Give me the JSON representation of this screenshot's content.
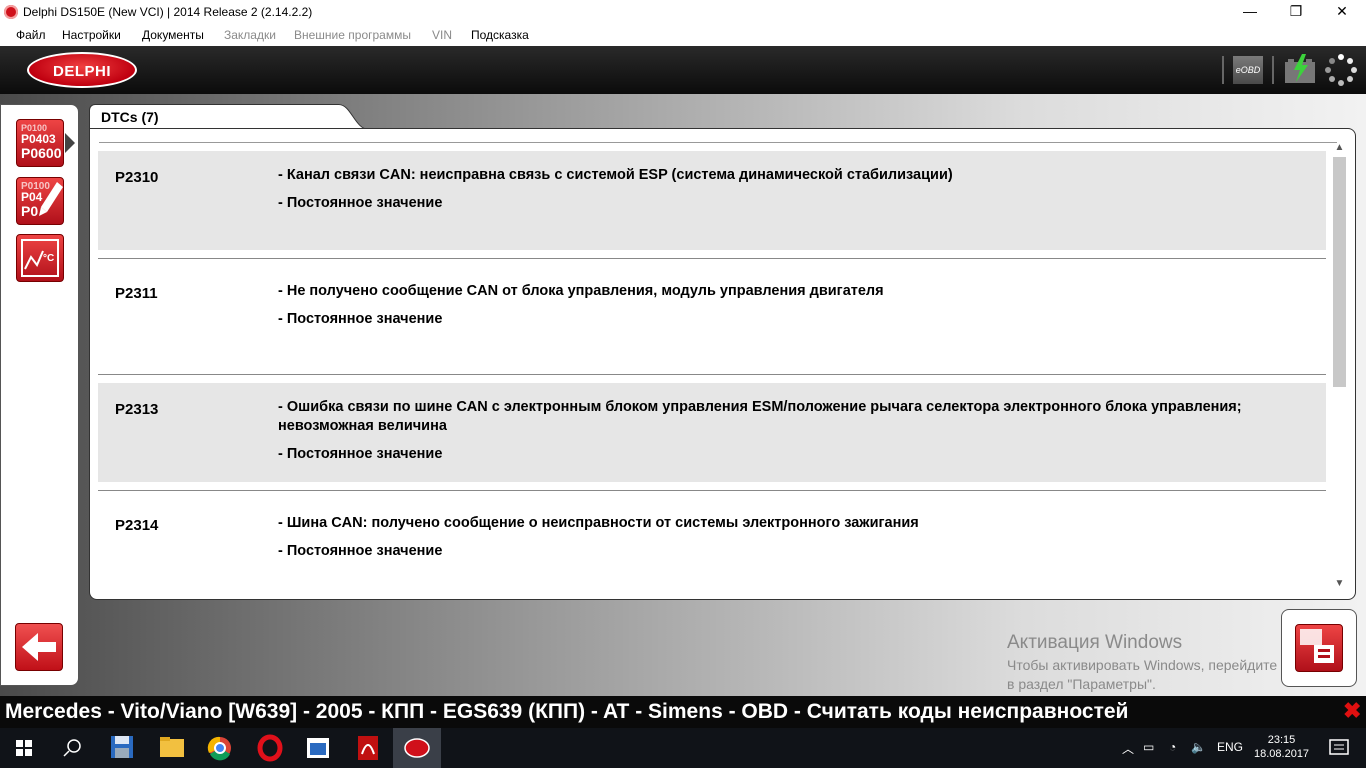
{
  "window": {
    "title": "Delphi DS150E (New VCI) | 2014 Release 2 (2.14.2.2)",
    "minimize_glyph": "—",
    "maximize_glyph": "❐",
    "close_glyph": "✕"
  },
  "menu": {
    "items": [
      {
        "label": "Файл",
        "enabled": true
      },
      {
        "label": "Настройки",
        "enabled": true
      },
      {
        "label": "Документы",
        "enabled": true
      },
      {
        "label": "Закладки",
        "enabled": false
      },
      {
        "label": "Внешние программы",
        "enabled": false
      },
      {
        "label": "VIN",
        "enabled": false
      },
      {
        "label": "Подсказка",
        "enabled": true
      }
    ]
  },
  "header": {
    "logo_text": "DELPHI",
    "eobd_label": "eOBD",
    "icons": [
      "eobd-icon",
      "battery-charge-icon",
      "loading-spinner-icon"
    ]
  },
  "sidebar": {
    "buttons": [
      {
        "name": "read-dtc-button",
        "lines": [
          "P0100",
          "P0403",
          "P0600"
        ],
        "icon": "read-codes-icon"
      },
      {
        "name": "clear-dtc-button",
        "lines": [
          "P0100",
          "P04",
          "P0"
        ],
        "icon": "clear-codes-icon"
      },
      {
        "name": "live-data-button",
        "icon": "live-data-icon"
      }
    ],
    "back_icon": "back-arrow-icon"
  },
  "dtc_panel": {
    "tab_label": "DTCs (7)",
    "rows": [
      {
        "code": "P2310",
        "description": "- Канал связи CAN: неисправна связь с системой ESP (система динамической стабилизации)",
        "status": "- Постоянное значение",
        "shaded": true
      },
      {
        "code": "P2311",
        "description": "- Не получено сообщение CAN от блока управления, модуль управления двигателя",
        "status": "- Постоянное значение",
        "shaded": false
      },
      {
        "code": "P2313",
        "description": "- Ошибка связи по шине CAN с электронным блоком управления ESM/положение рычага селектора электронного блока управления; невозможная величина",
        "status": "- Постоянное значение",
        "shaded": true
      },
      {
        "code": "P2314",
        "description": "- Шина CAN: получено сообщение о неисправности от системы электронного зажигания",
        "status": "- Постоянное значение",
        "shaded": false
      }
    ]
  },
  "watermark": {
    "title": "Активация Windows",
    "text": "Чтобы активировать Windows, перейдите в раздел \"Параметры\"."
  },
  "status_bar": {
    "text": "Mercedes - Vito/Viano [W639] - 2005 - КПП - EGS639 (КПП) - AT - Simens - OBD - Считать коды неисправностей",
    "close_glyph": "✖"
  },
  "taskbar": {
    "apps": [
      "start-icon",
      "search-icon",
      "save-icon",
      "explorer-icon",
      "chrome-icon",
      "opera-icon",
      "window-app-icon",
      "pdf-icon",
      "delphi-app-icon"
    ],
    "language": "ENG",
    "time": "23:15",
    "date": "18.08.2017"
  },
  "colors": {
    "accent_red": "#d0101a",
    "header_black": "#111111",
    "row_shade": "#e6e6e6"
  }
}
